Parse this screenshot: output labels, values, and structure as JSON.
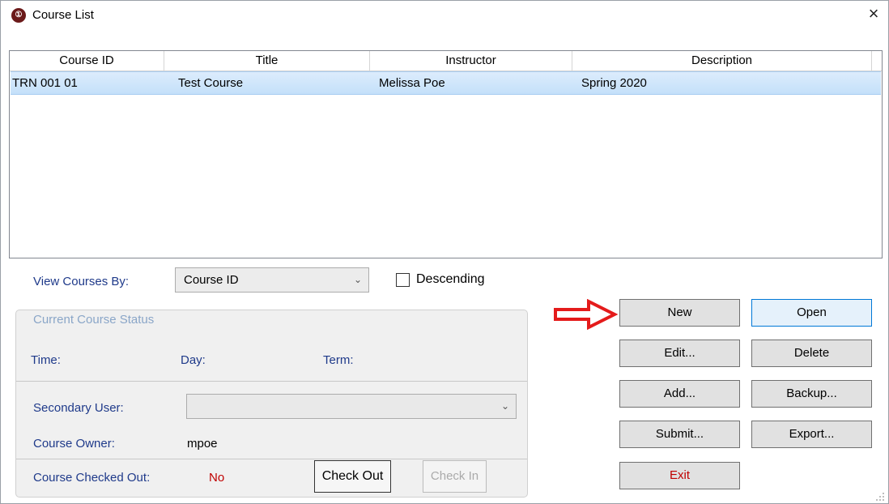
{
  "window": {
    "title": "Course List",
    "close_glyph": "×",
    "app_icon": "app-logo-icon",
    "app_icon_glyph": "①"
  },
  "list": {
    "columns": [
      "Course ID",
      "Title",
      "Instructor",
      "Description"
    ],
    "rows": [
      {
        "course_id": "TRN 001 01",
        "title": "Test Course",
        "instructor": "Melissa Poe",
        "description": "Spring 2020"
      }
    ],
    "selected_row_color": "#cce4fa"
  },
  "view_by": {
    "label": "View Courses By:",
    "value": "Course ID",
    "descending_label": "Descending",
    "descending_checked": false
  },
  "status": {
    "legend": "Current Course Status",
    "time_label": "Time:",
    "day_label": "Day:",
    "term_label": "Term:",
    "secondary_user_label": "Secondary User:",
    "secondary_user_value": "",
    "owner_label": "Course Owner:",
    "owner_value": "mpoe",
    "checked_out_label": "Course Checked Out:",
    "checked_out_value": "No",
    "check_out_label": "Check Out",
    "check_in_label": "Check In"
  },
  "buttons": {
    "new": "New",
    "open": "Open",
    "edit": "Edit...",
    "delete": "Delete",
    "add": "Add...",
    "backup": "Backup...",
    "submit": "Submit...",
    "export": "Export...",
    "exit": "Exit"
  },
  "colors": {
    "label_blue": "#1f3a8a",
    "legend_blue": "#8aa6c8",
    "exit_red": "#c00000",
    "no_red": "#c00000",
    "arrow_red": "#e41b1b",
    "default_button_border": "#0078d7"
  }
}
